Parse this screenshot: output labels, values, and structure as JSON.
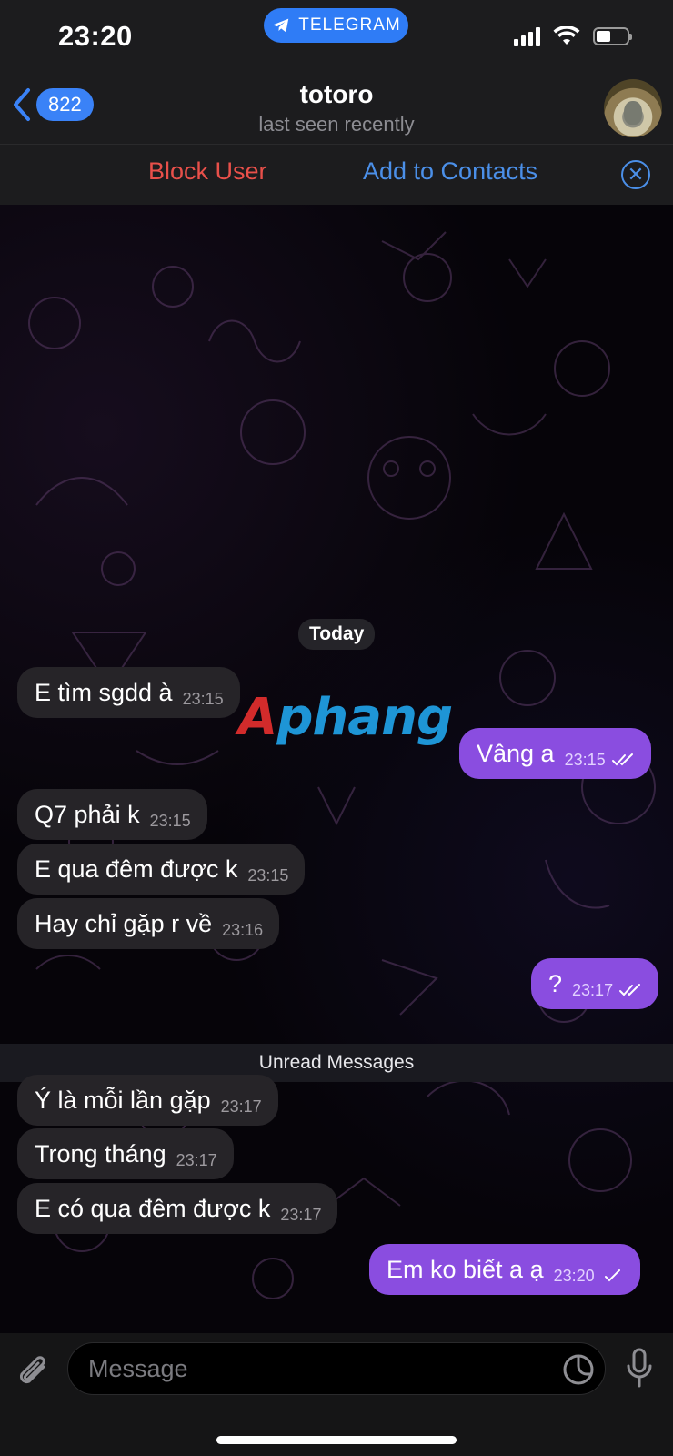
{
  "status_bar": {
    "time": "23:20",
    "app_pill": "TELEGRAM"
  },
  "header": {
    "back_count": "822",
    "title": "totoro",
    "subtitle": "last seen recently",
    "avatar_icon": "totoro-avatar"
  },
  "actions": {
    "block_label": "Block User",
    "add_label": "Add to Contacts",
    "close_icon": "close-circle-icon"
  },
  "chat": {
    "date_label": "Today",
    "watermark": {
      "part1": "A",
      "part2": "phang"
    },
    "messages_before": [
      {
        "text": "E tìm sgdd à",
        "time": "23:15",
        "outgoing": false
      },
      {
        "text": "Vâng a",
        "time": "23:15",
        "outgoing": true,
        "status": "read"
      },
      {
        "text": "Q7 phải k",
        "time": "23:15",
        "outgoing": false
      },
      {
        "text": "E qua đêm được k",
        "time": "23:15",
        "outgoing": false
      },
      {
        "text": "Hay chỉ gặp r về",
        "time": "23:16",
        "outgoing": false
      },
      {
        "text": "?",
        "time": "23:17",
        "outgoing": true,
        "status": "read"
      }
    ],
    "unread_label": "Unread Messages",
    "messages_after": [
      {
        "text": "Ý là mỗi lần gặp",
        "time": "23:17",
        "outgoing": false
      },
      {
        "text": "Trong tháng",
        "time": "23:17",
        "outgoing": false
      },
      {
        "text": "E có qua đêm được k",
        "time": "23:17",
        "outgoing": false
      },
      {
        "text": "Em ko biết a ạ",
        "time": "23:20",
        "outgoing": true,
        "status": "sent"
      }
    ]
  },
  "input": {
    "placeholder": "Message",
    "value": ""
  },
  "colors": {
    "accent": "#3a82f7",
    "danger": "#e8504a",
    "outgoing_bubble": "#8a4de0",
    "incoming_bubble": "#262428"
  }
}
